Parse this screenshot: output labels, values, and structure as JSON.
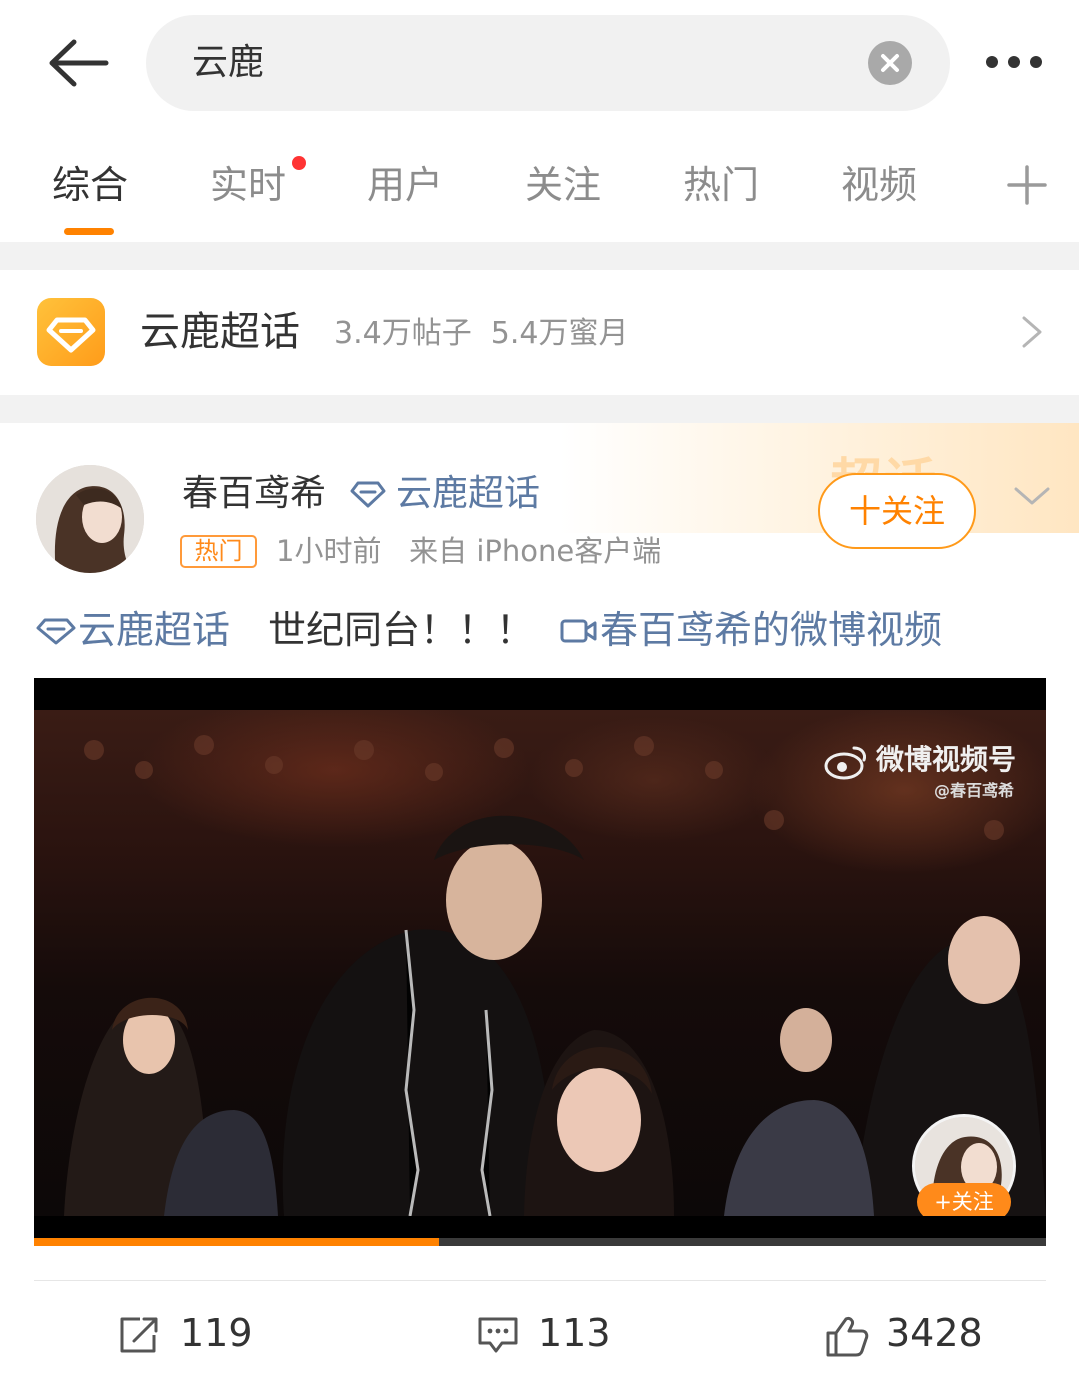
{
  "search": {
    "query": "云鹿",
    "clear_icon": "close-icon",
    "back_icon": "arrow-left-icon",
    "more_icon": "more-dots-icon"
  },
  "tabs": [
    {
      "label": "综合",
      "active": true
    },
    {
      "label": "实时",
      "has_dot": true
    },
    {
      "label": "用户"
    },
    {
      "label": "关注"
    },
    {
      "label": "热门"
    },
    {
      "label": "视频"
    }
  ],
  "supertopic": {
    "name": "云鹿超话",
    "stats": "3.4万帖子  5.4万蜜月"
  },
  "post": {
    "author": "春百鸢希",
    "author_topic": "云鹿超话",
    "badge": "热门",
    "meta": "1小时前   来自 iPhone客户端",
    "follow_label": "十关注",
    "header_decoration": "超话",
    "content": {
      "topic": "云鹿超话",
      "text": "世纪同台！！！",
      "video_link": "春百鸢希的微博视频"
    },
    "video": {
      "watermark_title": "微博视频号",
      "watermark_sub": "@春百鸢希",
      "mini_follow_label": "+关注",
      "progress": 0.4
    },
    "actions": {
      "repost": "119",
      "comment": "113",
      "like": "3428"
    }
  },
  "colors": {
    "accent": "#ff8200",
    "link": "#5d7aa3",
    "dot": "#ff3333"
  }
}
